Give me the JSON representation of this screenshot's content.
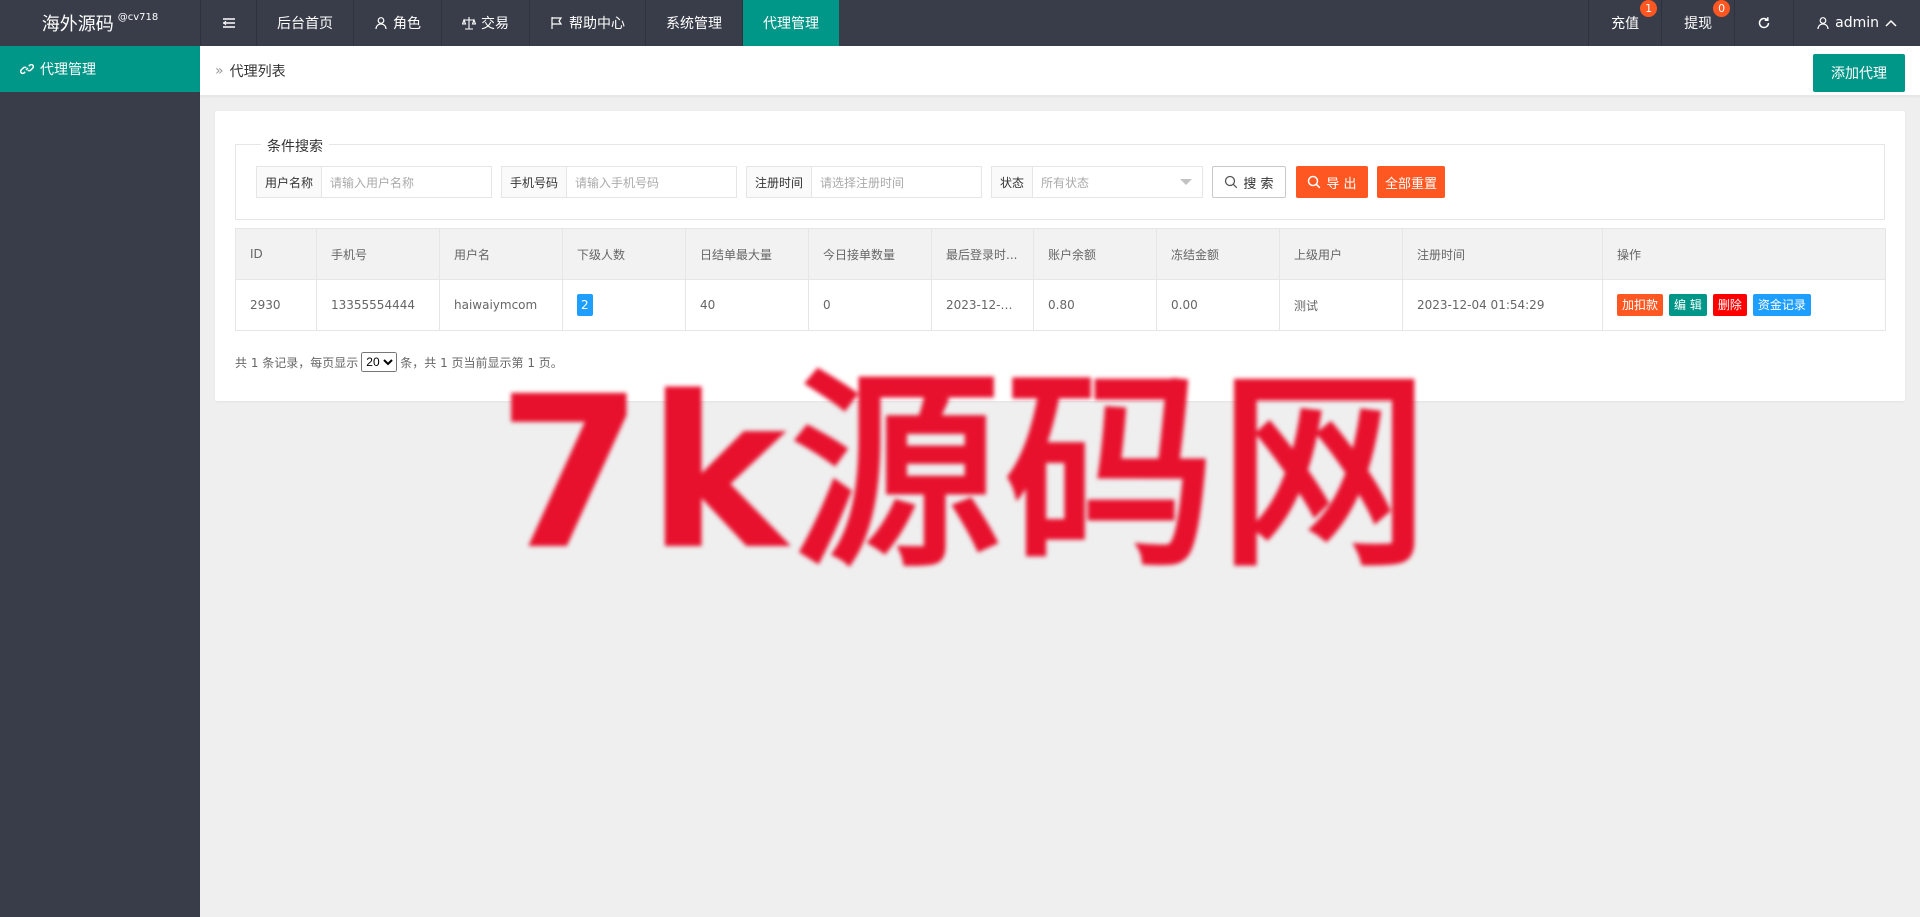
{
  "header": {
    "logo": "海外源码",
    "logo_sup": "@cv718",
    "nav": [
      {
        "label": "后台首页",
        "icon": ""
      },
      {
        "label": "角色",
        "icon": "user-icon"
      },
      {
        "label": "交易",
        "icon": "scale-icon"
      },
      {
        "label": "帮助中心",
        "icon": "flag-icon"
      },
      {
        "label": "系统管理",
        "icon": ""
      },
      {
        "label": "代理管理",
        "icon": "",
        "active": true
      }
    ],
    "right": {
      "recharge": "充值",
      "recharge_badge": "1",
      "withdraw": "提现",
      "withdraw_badge": "0",
      "user": "admin"
    }
  },
  "sidebar": {
    "items": [
      {
        "label": "代理管理",
        "icon": "link-icon",
        "active": true
      }
    ]
  },
  "breadcrumb": {
    "sep": "»",
    "current": "代理列表"
  },
  "toolbar": {
    "add_label": "添加代理"
  },
  "search": {
    "legend": "条件搜索",
    "fields": [
      {
        "label": "用户名称",
        "placeholder": "请输入用户名称"
      },
      {
        "label": "手机号码",
        "placeholder": "请输入手机号码"
      },
      {
        "label": "注册时间",
        "placeholder": "请选择注册时间"
      },
      {
        "label": "状态",
        "placeholder": "所有状态"
      }
    ],
    "search_label": "搜 索",
    "export_label": "导 出",
    "reset_label": "全部重置"
  },
  "table": {
    "columns": [
      "ID",
      "手机号",
      "用户名",
      "下级人数",
      "日结单最大量",
      "今日接单数量",
      "最后登录时...",
      "账户余额",
      "冻结金额",
      "上级用户",
      "注册时间",
      "操作"
    ],
    "rows": [
      {
        "id": "2930",
        "phone": "13355554444",
        "username": "haiwaiymcom",
        "subordinates": "2",
        "daily_max": "40",
        "today_count": "0",
        "last_login": "2023-12-0...",
        "balance": "0.80",
        "frozen": "0.00",
        "parent": "测试",
        "reg_time": "2023-12-04 01:54:29",
        "actions": [
          "加扣款",
          "编 辑",
          "删除",
          "资金记录"
        ]
      }
    ]
  },
  "pager": {
    "prefix": "共 1 条记录，每页显示",
    "page_size": "20",
    "suffix": "条，共 1 页当前显示第 1 页。"
  },
  "watermark": "7k源码网",
  "colors": {
    "header_bg": "#393d49",
    "accent": "#009688",
    "orange": "#ff5722",
    "blue": "#1e9fff",
    "red": "#ff0000",
    "watermark": "#e8112d"
  }
}
